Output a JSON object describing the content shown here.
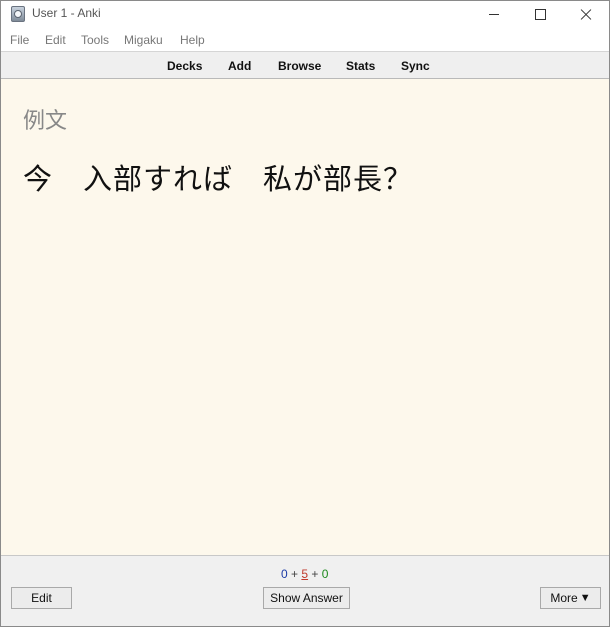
{
  "window": {
    "title": "User 1 - Anki"
  },
  "menu": [
    "File",
    "Edit",
    "Tools",
    "Migaku",
    "Help"
  ],
  "toolbar": [
    "Decks",
    "Add",
    "Browse",
    "Stats",
    "Sync"
  ],
  "card": {
    "field_label": "例文",
    "sentence": "今　入部すれば　私が部長？",
    "background_color": "#fdf8ec"
  },
  "counts": {
    "new": "0",
    "learning": "5",
    "review": "0",
    "separator": "+"
  },
  "buttons": {
    "edit": "Edit",
    "show_answer": "Show Answer",
    "more": "More",
    "more_arrow": "▼"
  },
  "icons": {
    "app": "anki-icon"
  }
}
